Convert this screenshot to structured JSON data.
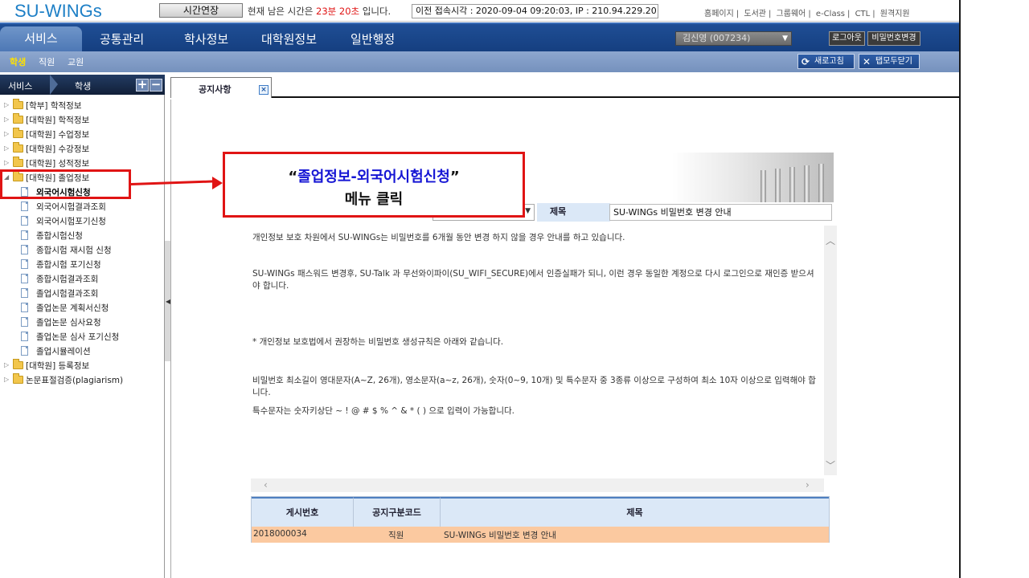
{
  "header": {
    "logo": "SU-WINGs",
    "extend_button": "시간연장",
    "remaining_prefix": "현재 남은 시간은 ",
    "remaining_time": "23분 20초",
    "remaining_suffix": " 입니다.",
    "last_login": "이전 접속시각 : 2020-09-04 09:20:03,   IP : 210.94.229.20",
    "links": [
      "홈페이지",
      "도서관",
      "그룹웨어",
      "e-Class",
      "CTL",
      "원격지원"
    ]
  },
  "nav": {
    "tabs": [
      "서비스",
      "공통관리",
      "학사정보",
      "대학원정보",
      "일반행정"
    ],
    "user": "김신영 (007234)",
    "logout": "로그아웃",
    "password_change": "비밀번호변경"
  },
  "subnav": {
    "items": [
      "학생",
      "직원",
      "교원"
    ],
    "refresh": "새로고침",
    "close_all": "탭모두닫기"
  },
  "sidebar": {
    "breadcrumb_service": "서비스",
    "breadcrumb_student": "학생",
    "expand": "+",
    "collapse": "−",
    "tree": [
      {
        "label": "[학부] 학적정보",
        "type": "folder"
      },
      {
        "label": "[대학원] 학적정보",
        "type": "folder"
      },
      {
        "label": "[대학원] 수업정보",
        "type": "folder"
      },
      {
        "label": "[대학원] 수강정보",
        "type": "folder"
      },
      {
        "label": "[대학원] 성적정보",
        "type": "folder"
      },
      {
        "label": "[대학원] 졸업정보",
        "type": "folder-open"
      },
      {
        "label": "외국어시험신청",
        "type": "doc",
        "selected": true
      },
      {
        "label": "외국어시험결과조회",
        "type": "doc"
      },
      {
        "label": "외국어시험포기신청",
        "type": "doc"
      },
      {
        "label": "종합시험신청",
        "type": "doc"
      },
      {
        "label": "종합시험 재시험 신청",
        "type": "doc"
      },
      {
        "label": "종합시험 포기신청",
        "type": "doc"
      },
      {
        "label": "종합시험결과조회",
        "type": "doc"
      },
      {
        "label": "졸업시험결과조회",
        "type": "doc"
      },
      {
        "label": "졸업논문 계획서신청",
        "type": "doc"
      },
      {
        "label": "졸업논문 심사요청",
        "type": "doc"
      },
      {
        "label": "졸업논문 심사 포기신청",
        "type": "doc"
      },
      {
        "label": "졸업시뮬레이션",
        "type": "doc"
      },
      {
        "label": "[대학원] 등록정보",
        "type": "folder"
      },
      {
        "label": "논문표절검증(plagiarism)",
        "type": "folder"
      }
    ]
  },
  "tab": {
    "label": "공지사항",
    "close": "×"
  },
  "notice": {
    "title_label": "제목",
    "title_value": "SU-WINGs 비밀번호 변경 안내",
    "paragraphs": [
      "개인정보 보호 차원에서 SU-WINGs는 비밀번호를 6개월 동안 변경 하지 않을 경우 안내를 하고 있습니다.",
      "SU-WINGs 패스워드 변경후, SU-Talk 과 무선와이파이(SU_WIFI_SECURE)에서 인증실패가 되니, 이런 경우 동일한 계정으로 다시 로그인으로 재인증 받으셔야 합니다.",
      "* 개인정보 보호법에서 권장하는 비밀번호 생성규칙은 아래와 같습니다.",
      "비밀번호 최소길이 영대문자(A~Z, 26개), 영소문자(a~z, 26개), 숫자(0~9, 10개) 및 특수문자 중 3종류 이상으로 구성하여 최소 10자 이상으로 입력해야 합니다.",
      "특수문자는 숫자키상단 ~ ! @ # $ % ^ & * ( ) 으로 입력이 가능합니다."
    ]
  },
  "grid": {
    "columns": [
      "게시번호",
      "공지구분코드",
      "제목"
    ],
    "rows": [
      {
        "id": "2018000034",
        "category": "직원",
        "title": "SU-WINGs 비밀번호 변경 안내"
      }
    ]
  },
  "annotation": {
    "line1_open": "“",
    "line1_highlight": "졸업정보-외국어시험신청",
    "line1_close": "”",
    "line2": "메뉴 클릭"
  },
  "colors": {
    "nav_bg": "#1f4e95",
    "highlight_red": "#e01414",
    "selected_row": "#fbc9a0",
    "subnav_active": "#ffe100"
  }
}
